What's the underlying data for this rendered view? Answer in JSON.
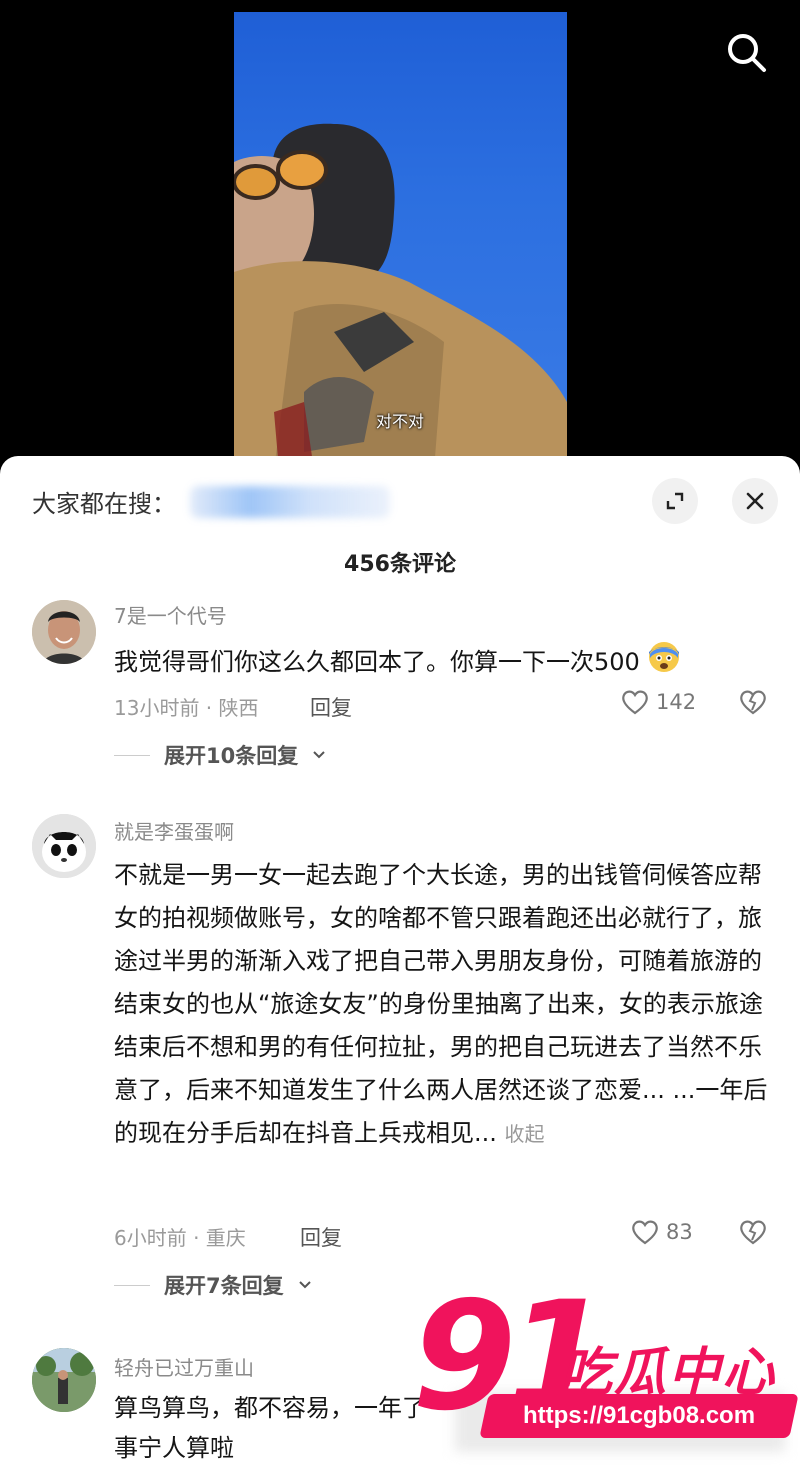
{
  "video": {
    "subtitle": "对不对"
  },
  "sheet": {
    "search_hint": "大家都在搜：",
    "comment_count": "456条评论"
  },
  "comments": [
    {
      "username": "7是一个代号",
      "text": "我觉得哥们你这么久都回本了。你算一下一次500",
      "time_location": "13小时前 · 陕西",
      "reply_label": "回复",
      "likes": "142",
      "expand_label": "展开10条回复"
    },
    {
      "username": "就是李蛋蛋啊",
      "text": "不就是一男一女一起去跑了个大长途，男的出钱管伺候答应帮女的拍视频做账号，女的啥都不管只跟着跑还出必就行了，旅途过半男的渐渐入戏了把自己带入男朋友身份，可随着旅游的结束女的也从“旅途女友”的身份里抽离了出来，女的表示旅途结束后不想和男的有任何拉扯，男的把自己玩进去了当然不乐意了，后来不知道发生了什么两人居然还谈了恋爱... ...一年后的现在分手后却在抖音上兵戎相见...",
      "collapse_label": "收起",
      "time_location": "6小时前 · 重庆",
      "reply_label": "回复",
      "likes": "83",
      "expand_label": "展开7条回复"
    },
    {
      "username": "轻舟已过万重山",
      "text_line1": "算鸟算鸟，都不容易，一年了",
      "text_line2": "事宁人算啦"
    }
  ],
  "watermark": {
    "number": "91",
    "brand": "吃瓜中心",
    "url": "https://91cgb08.com"
  },
  "colors": {
    "accent": "#f0135c",
    "sky": "#2c6fe0"
  }
}
